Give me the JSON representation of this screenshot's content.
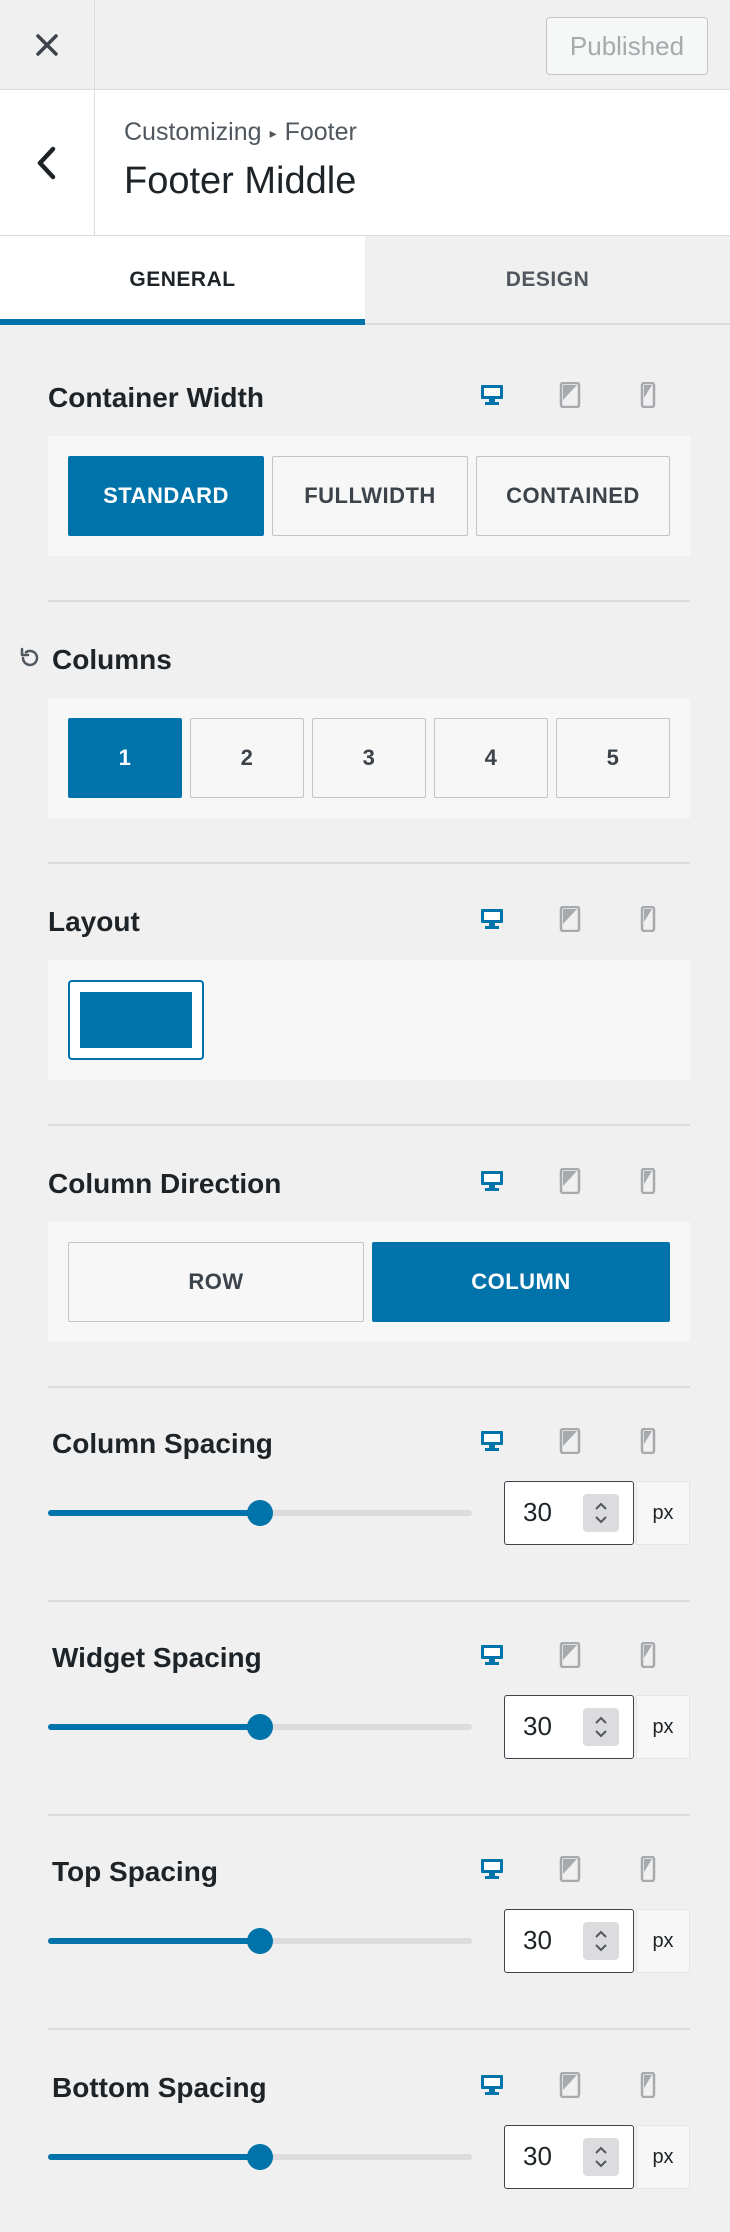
{
  "header": {
    "published_label": "Published"
  },
  "section": {
    "breadcrumb_root": "Customizing",
    "breadcrumb_separator": "▸",
    "breadcrumb_parent": "Footer",
    "title": "Footer Middle"
  },
  "tabs": [
    {
      "label": "GENERAL",
      "active": true
    },
    {
      "label": "DESIGN",
      "active": false
    }
  ],
  "container_width": {
    "label": "Container Width",
    "options": [
      "STANDARD",
      "FULLWIDTH",
      "CONTAINED"
    ],
    "selected": "STANDARD"
  },
  "columns": {
    "label": "Columns",
    "options": [
      "1",
      "2",
      "3",
      "4",
      "5"
    ],
    "selected": "1"
  },
  "layout": {
    "label": "Layout"
  },
  "column_direction": {
    "label": "Column Direction",
    "options": [
      "ROW",
      "COLUMN"
    ],
    "selected": "COLUMN"
  },
  "spacings": [
    {
      "label": "Column Spacing",
      "value": "30",
      "unit": "px",
      "fraction": 0.5
    },
    {
      "label": "Widget Spacing",
      "value": "30",
      "unit": "px",
      "fraction": 0.5
    },
    {
      "label": "Top Spacing",
      "value": "30",
      "unit": "px",
      "fraction": 0.5
    },
    {
      "label": "Bottom Spacing",
      "value": "30",
      "unit": "px",
      "fraction": 0.5
    }
  ],
  "device_icons": [
    "desktop-icon",
    "tablet-icon",
    "mobile-icon"
  ],
  "colors": {
    "accent": "#0073aa",
    "active_device": "#0073aa",
    "inactive_device": "#a7aaad"
  }
}
